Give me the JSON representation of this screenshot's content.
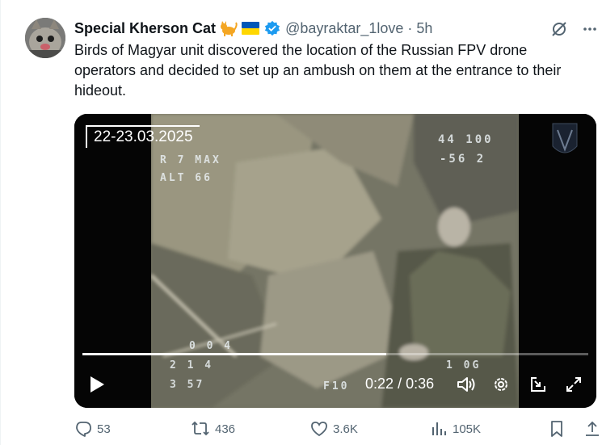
{
  "tweet": {
    "author_name": "Special Kherson Cat",
    "handle": "@bayraktar_1love",
    "separator": "·",
    "time": "5h",
    "text": "Birds of Magyar unit discovered the location of the Russian FPV drone operators and decided to set up an ambush on them at the entrance to their hideout.",
    "verified": true
  },
  "icons": {
    "grok": "grok-icon",
    "more": "more-icon",
    "verified": "verified-badge-icon"
  },
  "media": {
    "date_overlay": "22-23.03.2025",
    "osd_top_right_1": "44 100",
    "osd_top_right_2": "-56 2",
    "osd_left_1": "R 7 MAX",
    "osd_left_2": "ALT 66",
    "osd_bottom_1": "0 0 4",
    "osd_bottom_2": "2 1 4",
    "osd_bottom_3": "3 57",
    "osd_bottom_right": "1 0G",
    "osd_bottom_mid": "F10",
    "current_time": "0:22",
    "time_separator": "/",
    "duration": "0:36",
    "progress": 0.6
  },
  "actions": {
    "replies": "53",
    "reposts": "436",
    "likes": "3.6K",
    "views": "105K"
  },
  "colors": {
    "text": "#0f1419",
    "secondary": "#536471",
    "verified": "#1d9bf0"
  }
}
